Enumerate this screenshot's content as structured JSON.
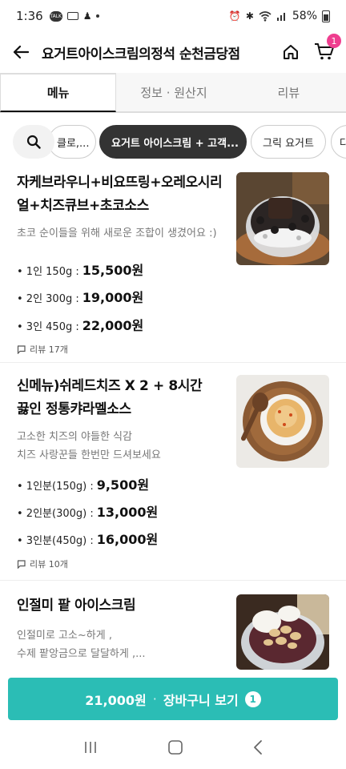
{
  "status_bar": {
    "time": "1:36",
    "battery": "58%"
  },
  "header": {
    "title": "요거트아이스크림의정석 순천금당점",
    "cart_badge": "1"
  },
  "tabs": [
    {
      "label": "메뉴",
      "active": true
    },
    {
      "label": "정보 · 원산지",
      "active": false
    },
    {
      "label": "리뷰",
      "active": false
    }
  ],
  "chips": [
    {
      "label": "클로,..."
    },
    {
      "label": "요거트 아이스크림 + 고객...",
      "selected": true
    },
    {
      "label": "그릭 요거트"
    },
    {
      "label": "다"
    }
  ],
  "menu_items": [
    {
      "name_line1": "자케브라우니+비요뜨링+오레오시리",
      "name_line2": "얼+치즈큐브+초코소스",
      "desc_line1": "초코 순이들을 위해 새로운 조합이 생겼어요 :)",
      "desc_line2": "",
      "prices": [
        {
          "label": "• 1인 150g :",
          "value": "15,500원"
        },
        {
          "label": "• 2인 300g :",
          "value": "19,000원"
        },
        {
          "label": "• 3인 450g :",
          "value": "22,000원"
        }
      ],
      "review": "리뷰 17개"
    },
    {
      "name_line1": "신메뉴)쉬레드치즈 X 2 + 8시간",
      "name_line2": "끓인 정통캬라멜소스",
      "desc_line1": "고소한 치즈의 야들한 식감",
      "desc_line2": "치즈 사랑꾼들 한번만 드셔보세요",
      "prices": [
        {
          "label": "• 1인분(150g) :",
          "value": "9,500원"
        },
        {
          "label": "• 2인분(300g) :",
          "value": "13,000원"
        },
        {
          "label": "• 3인분(450g) :",
          "value": "16,000원"
        }
      ],
      "review": "리뷰 10개"
    },
    {
      "name_line1": "인절미 팥 아이스크림",
      "name_line2": "",
      "desc_line1": "인절미로 고소~하게 ,",
      "desc_line2": "수제 팥앙금으로 달달하게 ,..."
    }
  ],
  "cart_bar": {
    "total": "21,000원",
    "separator": "·",
    "label": "장바구니 보기",
    "count": "1"
  },
  "colors": {
    "accent": "#2bbdb5",
    "badge": "#ef3e8f",
    "chip_selected": "#333333"
  }
}
